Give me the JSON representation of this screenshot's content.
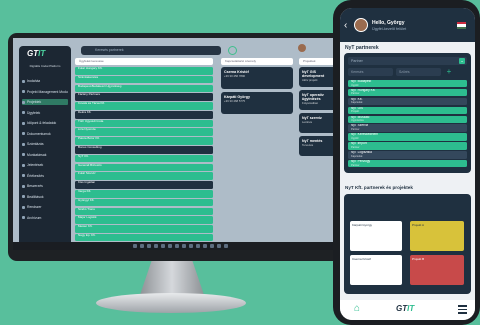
{
  "brand": {
    "logo": "GT",
    "logo_accent": "IT",
    "phone_logo": "GT",
    "phone_logo_accent": "IT",
    "accent": "#2dbd8f",
    "dark": "#1f3040"
  },
  "desktop": {
    "sidebar": {
      "subtitle": "Digitális Irodai Platform",
      "items": [
        "Irodaház",
        "Projekt Management Modul",
        "Projektek",
        "Ügyfelek",
        "Időpont & feladatok",
        "Dokumentumok",
        "Számlázás",
        "Munkatársak",
        "Jelentések",
        "Értékesítés",
        "Beszerzés",
        "Beállítások",
        "Rendszer",
        "Archívum"
      ],
      "footer": "Szolgáltatás: Partnerek"
    },
    "search_placeholder": "Keresés partnerek",
    "columns": [
      {
        "head": "Ügyfelek keresése",
        "rows": [
          "Futar Hungary Kft.",
          "Számlakezelés",
          "Budapest-Budakeszi Ügynökség",
          "Fácány Partnere",
          "Kováts és Társa Kft.",
          "Dekra Kft.",
          "Tóth Ügyvédi Iroda",
          "Liza Nyomda",
          "Palota Bútor Kft.",
          "Bonus Consulting",
          "NyT Kft.",
          "Generali Biztosító",
          "Futár Szerviz",
          "Kiss Ingatlan",
          "Varga Kft.",
          "Gyöngyi Kft.",
          "Szabó Trans",
          "Major Logistik",
          "Mester Kft.",
          "Nagy Ép. Kft.",
          "Stúdió Kft.",
          "Kelemen Autó",
          "Bodó Kft.",
          "Fodor Kft.",
          "Zsolt Trans",
          "Domb Kft."
        ]
      },
      {
        "head": "Kapcsolattartó személy",
        "cards": [
          {
            "name": "Cserna Kristóf",
            "info": "+36 30 456 7890"
          },
          {
            "name": "Kárpáti György",
            "info": "+36 30 468 5775"
          }
        ]
      },
      {
        "head": "Projektek",
        "cards": [
          {
            "name": "NyT GIS development",
            "info": "Aktív projekt"
          },
          {
            "name": "NyT operatív ügyintézés",
            "info": "Folyamatban"
          },
          {
            "name": "NyT szerviz",
            "info": "Lezárva"
          },
          {
            "name": "NyT mentés",
            "info": "Tervezés"
          }
        ]
      }
    ]
  },
  "phone": {
    "greeting": "Hello, György",
    "user_sub": "Ügyfél-kezelő felület",
    "section_title": "NyT partnerek",
    "select_label": "Partner",
    "search_a": "Keresés",
    "search_b": "Szűrés",
    "rows": [
      {
        "label": "NyT Budapest",
        "sub": "Ügyfél",
        "t": "g"
      },
      {
        "label": "NyT Hungary Kft.",
        "sub": "Partner",
        "t": "g"
      },
      {
        "label": "NyT Kft.",
        "sub": "Kapcsolat",
        "t": "d"
      },
      {
        "label": "NyT GIS",
        "sub": "Projekt",
        "t": "g"
      },
      {
        "label": "NyT Műszaki",
        "sub": "Ügyintézés",
        "t": "g"
      },
      {
        "label": "NyT Szerviz",
        "sub": "Partner",
        "t": "d"
      },
      {
        "label": "NyT Kereskedelem",
        "sub": "Ügyfél",
        "t": "g"
      },
      {
        "label": "NyT Import",
        "sub": "Partner",
        "t": "g"
      },
      {
        "label": "NyT Logisztika",
        "sub": "Kapcsolat",
        "t": "d"
      },
      {
        "label": "NyT Pénzügy",
        "sub": "Partner",
        "t": "g"
      }
    ],
    "section2_title": "NyT Kft. partnerek és projektek",
    "cards2": [
      "Kárpáti György",
      "Projekt A",
      "Cserna Kristóf",
      "Projekt B"
    ]
  }
}
